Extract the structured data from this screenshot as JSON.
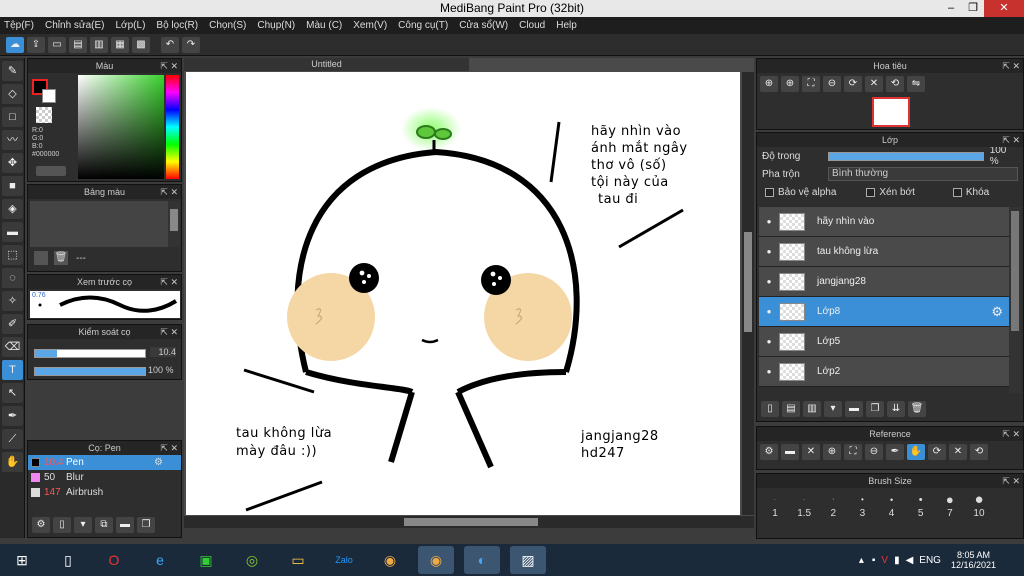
{
  "window": {
    "title": "MediBang Paint Pro (32bit)"
  },
  "menu": [
    "Tệp(F)",
    "Chỉnh sửa(E)",
    "Lớp(L)",
    "Bộ lọc(R)",
    "Chọn(S)",
    "Chụp(N)",
    "Màu (C)",
    "Xem(V)",
    "Công cụ(T)",
    "Cửa sổ(W)",
    "Cloud",
    "Help"
  ],
  "color_panel": {
    "title": "Màu",
    "r": "R:0",
    "g": "G:0",
    "b": "B:0",
    "hex": "#000000"
  },
  "palette_panel": {
    "title": "Bảng màu",
    "value": "---"
  },
  "brush_preview": {
    "title": "Xem trước cọ",
    "size": "0.76"
  },
  "brush_control": {
    "title": "Kiểm soát cọ",
    "size": "10.4",
    "opacity": "100 %"
  },
  "brush_list": {
    "title": "Cọ: Pen",
    "items": [
      {
        "size": "10.4",
        "name": "Pen",
        "color": "#000000",
        "selected": true
      },
      {
        "size": "50",
        "name": "Blur",
        "color": "#ee88ee",
        "selected": false
      },
      {
        "size": "147",
        "name": "Airbrush",
        "color": "#dddddd",
        "selected": false
      }
    ]
  },
  "document": {
    "tab": "Untitled"
  },
  "drawing": {
    "text_top": [
      "hãy nhìn vào",
      "ánh mắt ngây",
      "thơ vô (số)",
      "tội này của",
      "tau đi"
    ],
    "text_left": [
      "tau không lừa",
      "mày đâu :))"
    ],
    "text_right": [
      "jangjang28",
      "hd247"
    ],
    "sprout_color": "#5cc83a",
    "blush_color": "#f5d7a5"
  },
  "navigator": {
    "title": "Hoa tiêu"
  },
  "layer_panel": {
    "title": "Lớp",
    "opacity_label": "Độ trong",
    "opacity_value": "100 %",
    "blend_label": "Pha trộn",
    "blend_value": "Bình thường",
    "protect_alpha": "Bảo vệ alpha",
    "clip": "Xén bớt",
    "lock": "Khóa",
    "layers": [
      {
        "name": "hãy nhìn vào",
        "selected": false
      },
      {
        "name": "tau không lừa",
        "selected": false
      },
      {
        "name": "jangjang28",
        "selected": false
      },
      {
        "name": "Lớp8",
        "selected": true
      },
      {
        "name": "Lớp5",
        "selected": false
      },
      {
        "name": "Lớp2",
        "selected": false
      }
    ]
  },
  "reference_panel": {
    "title": "Reference"
  },
  "brush_size_panel": {
    "title": "Brush Size",
    "sizes": [
      "1",
      "1.5",
      "2",
      "3",
      "4",
      "5",
      "7",
      "10"
    ]
  },
  "taskbar": {
    "lang": "ENG",
    "time": "8:05 AM",
    "date": "12/16/2021"
  }
}
